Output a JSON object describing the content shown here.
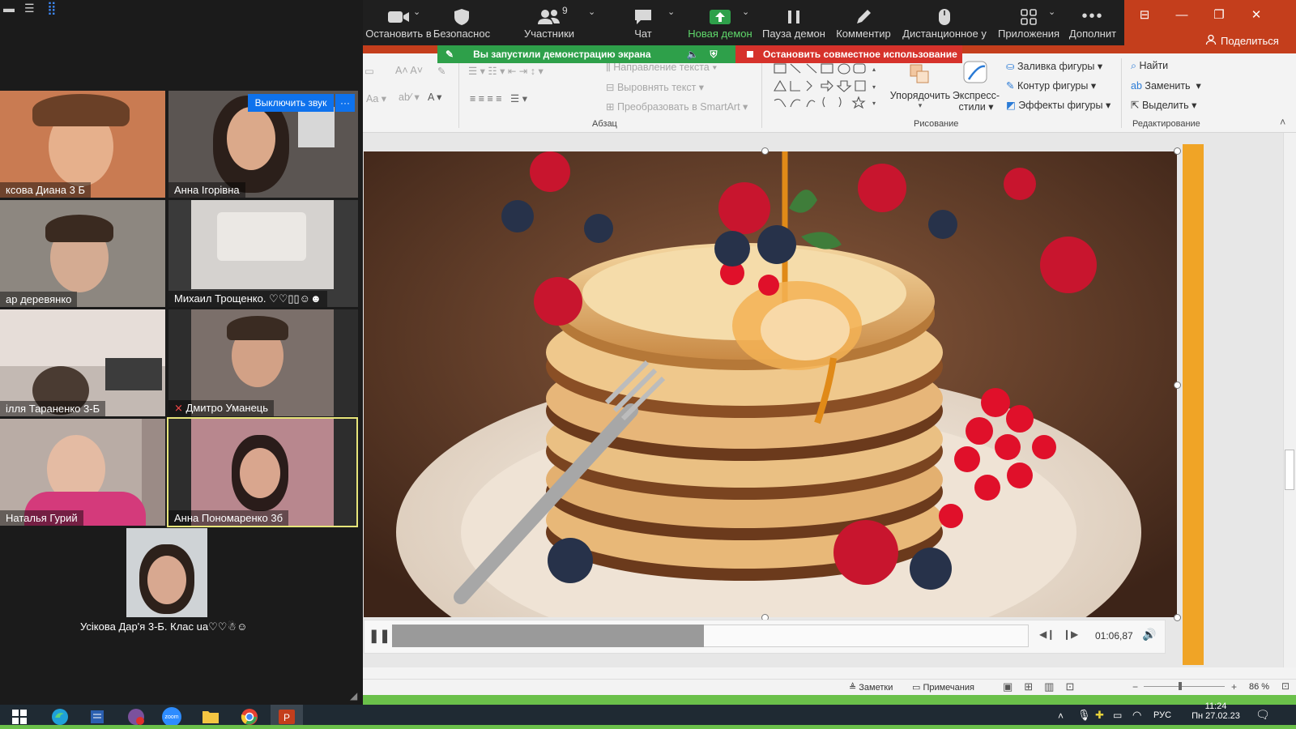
{
  "zoom": {
    "toolbar": {
      "stop_video": "Остановить в",
      "security": "Безопаснос",
      "participants": "Участники",
      "participants_count": "9",
      "chat": "Чат",
      "new_share": "Новая демон",
      "pause_share": "Пауза демон",
      "annotate": "Комментир",
      "remote_control": "Дистанционное у",
      "apps": "Приложения",
      "more": "Дополнит"
    },
    "share_banner": "Вы запустили демонстрацию экрана",
    "stop_share": "Остановить совместное использование",
    "mute_button": "Выключить звук",
    "participants": [
      {
        "name": "ксова Диана 3 Б"
      },
      {
        "name": "Анна Ігорівна"
      },
      {
        "name": "ар деревянко"
      },
      {
        "name": "Михаил Трощенко. ♡♡▯▯☺☻"
      },
      {
        "name": "ілля Тараненко 3-Б"
      },
      {
        "name": "Дмитро Уманець"
      },
      {
        "name": "Наталья Гурий"
      },
      {
        "name": "Анна Пономаренко 3б"
      },
      {
        "name": "Усікова Дар'я 3-Б. Клас ua♡♡☃☺"
      }
    ],
    "colors": {
      "active_speaker_border": "#e7e57a",
      "share_green": "#2ea04a",
      "stop_red": "#d6322b"
    }
  },
  "powerpoint": {
    "share_button": "Поделиться",
    "ribbon": {
      "paragraph": {
        "text_direction": "Направление текста",
        "align_text": "Выровнять текст",
        "smartart": "Преобразовать в SmartArt",
        "label": "Абзац"
      },
      "drawing": {
        "arrange": "Упорядочить",
        "quick_styles_1": "Экспресс-",
        "quick_styles_2": "стили",
        "shape_fill": "Заливка фигуры",
        "shape_outline": "Контур фигуры",
        "shape_effects": "Эффекты фигуры",
        "label": "Рисование"
      },
      "editing": {
        "find": "Найти",
        "replace": "Заменить",
        "select": "Выделить",
        "label": "Редактирование"
      }
    },
    "video": {
      "time": "01:06,87",
      "progress": 0.49
    },
    "status_bar": {
      "notes": "Заметки",
      "comments": "Примечания",
      "zoom": "86 %"
    },
    "accent_color": "#f0a426"
  },
  "taskbar": {
    "zoom_app_label": "zoom",
    "language": "РУС",
    "time": "11:24",
    "date": "Пн 27.02.23"
  }
}
